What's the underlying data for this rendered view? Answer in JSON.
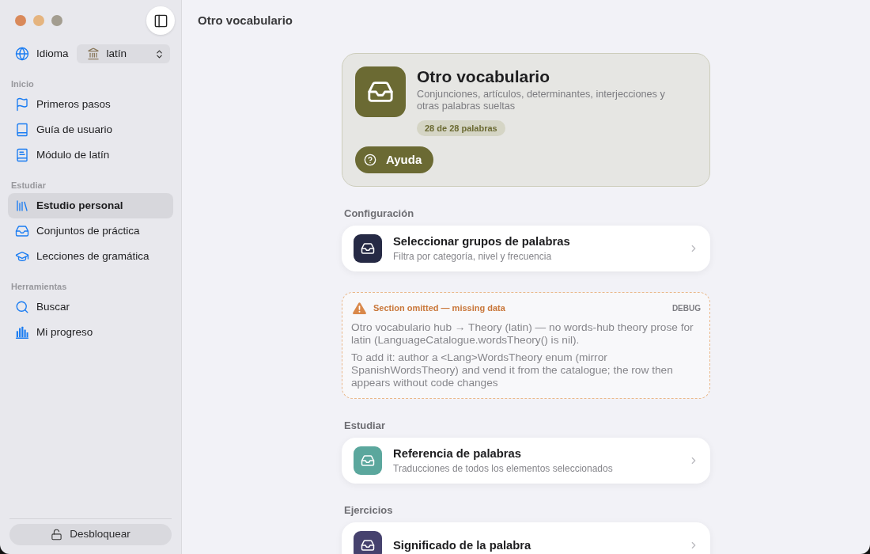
{
  "sidebar": {
    "language": {
      "label": "Idioma",
      "value": "latín"
    },
    "sections": [
      {
        "title": "Inicio",
        "items": [
          {
            "label": "Primeros pasos",
            "selected": false
          },
          {
            "label": "Guía de usuario",
            "selected": false
          },
          {
            "label": "Módulo de latín",
            "selected": false
          }
        ]
      },
      {
        "title": "Estudiar",
        "items": [
          {
            "label": "Estudio personal",
            "selected": true
          },
          {
            "label": "Conjuntos de práctica",
            "selected": false
          },
          {
            "label": "Lecciones de gramática",
            "selected": false
          }
        ]
      },
      {
        "title": "Herramientas",
        "items": [
          {
            "label": "Buscar",
            "selected": false
          },
          {
            "label": "Mi progreso",
            "selected": false
          }
        ]
      }
    ],
    "unlock_button": "Desbloquear"
  },
  "main": {
    "title": "Otro vocabulario",
    "hero": {
      "title": "Otro vocabulario",
      "description": "Conjunciones, artículos, determinantes, interjecciones y otras palabras sueltas",
      "count": "28 de 28 palabras",
      "help_button": "Ayuda"
    },
    "blocks": [
      {
        "kind": "section",
        "title": "Configuración",
        "rows": [
          {
            "title": "Seleccionar grupos de palabras",
            "subtitle": "Filtra por categoría, nivel y frecuencia",
            "color": "#262a45"
          }
        ]
      },
      {
        "kind": "notice",
        "title": "Section omitted — missing data",
        "tag": "DEBUG",
        "paragraphs": [
          "Otro vocabulario hub → Theory (latin) — no words-hub theory prose for latin (LanguageCatalogue.wordsTheory() is nil).",
          "To add it: author a <Lang>WordsTheory enum (mirror SpanishWordsTheory) and vend it from the catalogue; the row then appears without code changes"
        ]
      },
      {
        "kind": "section",
        "title": "Estudiar",
        "rows": [
          {
            "title": "Referencia de palabras",
            "subtitle": "Traducciones de todos los elementos seleccionados",
            "color": "#5ba79d"
          }
        ]
      },
      {
        "kind": "section",
        "title": "Ejercicios",
        "rows": [
          {
            "title": "Significado de la palabra",
            "color": "#46426e"
          }
        ]
      }
    ]
  }
}
